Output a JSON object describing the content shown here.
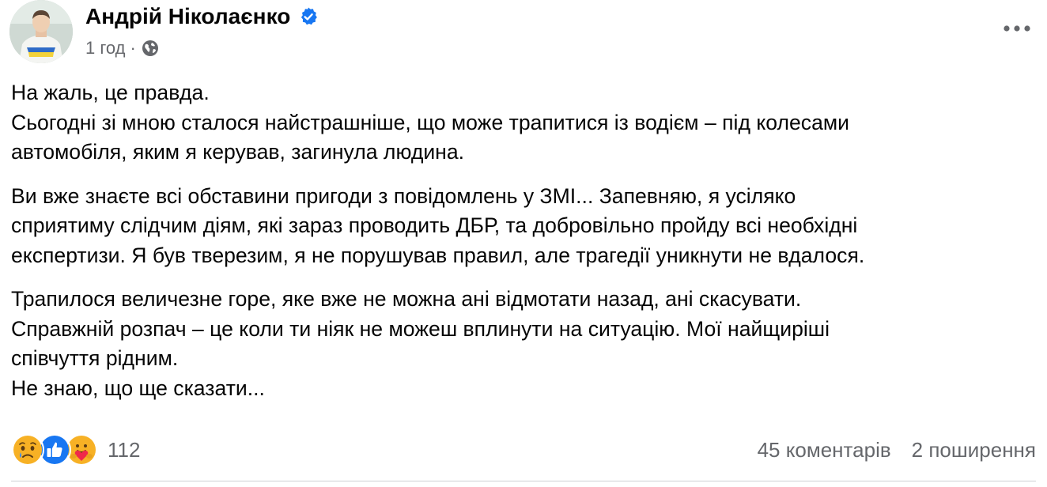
{
  "post": {
    "author": "Андрій Ніколаєнко",
    "time": "1 год",
    "separator": "·",
    "verified_icon": "verified-badge-icon",
    "audience_icon": "globe-icon",
    "paragraphs": [
      {
        "lines": [
          "На жаль, це правда.",
          "Сьогодні зі мною сталося найстрашніше, що може трапитися із водієм – під колесами",
          "автомобіля, яким я керував, загинула людина."
        ]
      },
      {
        "lines": [
          "Ви вже знаєте всі обставини пригоди з повідомлень у ЗМІ... Запевняю, я усіляко",
          "сприятиму слідчим діям, які зараз проводить ДБР, та добровільно пройду всі необхідні",
          "експертизи. Я був тверезим, я не порушував правил, але трагедії уникнути не вдалося."
        ]
      },
      {
        "lines": [
          "Трапилося величезне горе, яке вже не можна ані відмотати назад, ані скасувати.",
          "Справжній розпач – це коли ти ніяк не можеш вплинути на ситуацію. Мої найщиріші",
          "співчуття рідним.",
          "Не знаю, що ще сказати..."
        ]
      }
    ],
    "reactions": {
      "icons": [
        "sad-reaction-icon",
        "like-reaction-icon",
        "care-reaction-icon"
      ],
      "count": "112"
    },
    "comments": "45 коментарів",
    "shares": "2 поширення"
  },
  "colors": {
    "text": "#050505",
    "secondary": "#65676b",
    "verified": "#1877f2",
    "like": "#1877f2",
    "sad": "#f7b125"
  }
}
